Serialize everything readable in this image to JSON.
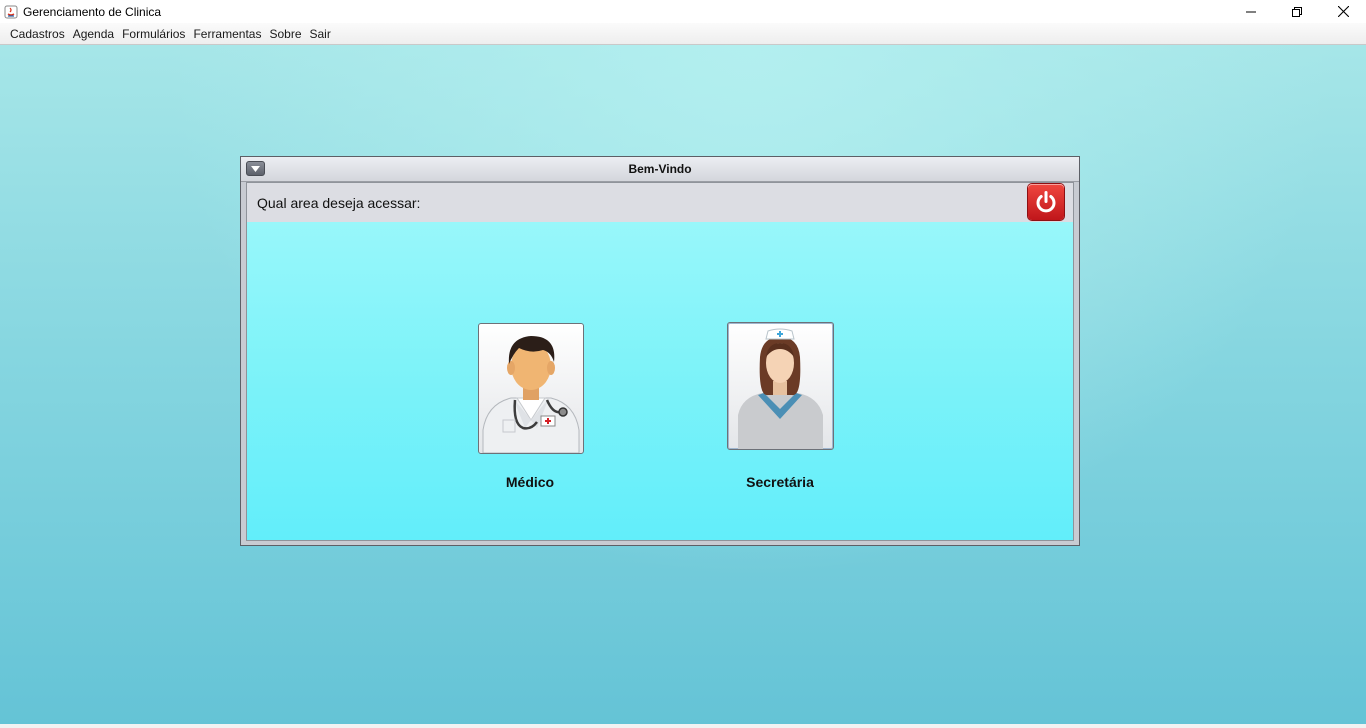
{
  "window": {
    "title": "Gerenciamento de Clinica"
  },
  "menubar": {
    "items": [
      "Cadastros",
      "Agenda",
      "Formulários",
      "Ferramentas",
      "Sobre",
      "Sair"
    ]
  },
  "dialog": {
    "title": "Bem-Vindo",
    "question": "Qual area deseja acessar:",
    "roles": [
      {
        "label": "Médico",
        "icon": "doctor-icon"
      },
      {
        "label": "Secretária",
        "icon": "nurse-icon"
      }
    ],
    "exit_icon": "power-icon"
  },
  "colors": {
    "desktop_top": "#a6e6e8",
    "desktop_bottom": "#64c3d6",
    "panel_top": "#9ff8fb",
    "panel_bottom": "#62eefa",
    "power_red": "#d42026"
  }
}
